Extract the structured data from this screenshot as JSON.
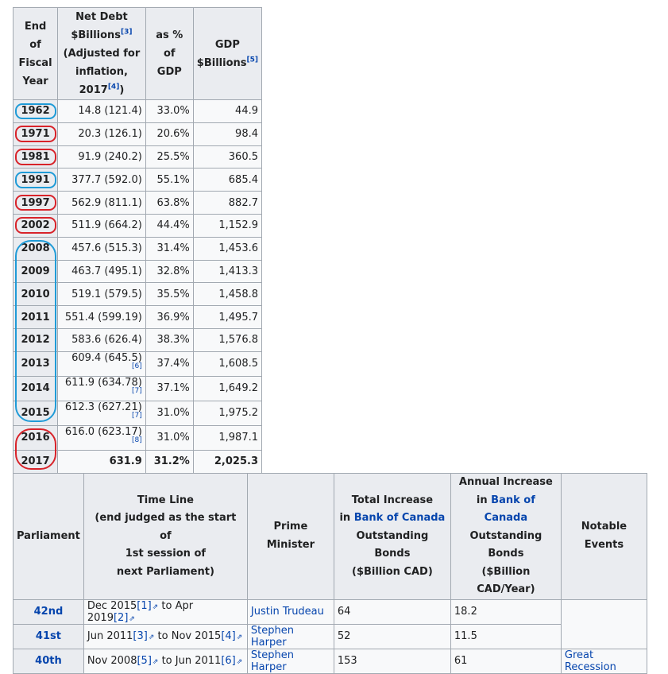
{
  "debt_table": {
    "headers": {
      "year_line1": "End",
      "year_line2": "of",
      "year_line3": "Fiscal",
      "year_line4": "Year",
      "net_debt_line1": "Net Debt",
      "net_debt_line2": "$Billions",
      "net_debt_ref": "[3]",
      "net_debt_line3": "(Adjusted for",
      "net_debt_line4": "inflation, 2017",
      "net_debt_ref2": "[4]",
      "net_debt_close": ")",
      "pct_line1": "as % of",
      "pct_line2": "GDP",
      "gdp_line1": "GDP",
      "gdp_line2": "$Billions",
      "gdp_ref": "[5]"
    },
    "rows": [
      {
        "year": "1962",
        "debt": "14.8 (121.4)",
        "ref": "",
        "pct": "33.0%",
        "gdp": "44.9"
      },
      {
        "year": "1971",
        "debt": "20.3 (126.1)",
        "ref": "",
        "pct": "20.6%",
        "gdp": "98.4"
      },
      {
        "year": "1981",
        "debt": "91.9 (240.2)",
        "ref": "",
        "pct": "25.5%",
        "gdp": "360.5"
      },
      {
        "year": "1991",
        "debt": "377.7 (592.0)",
        "ref": "",
        "pct": "55.1%",
        "gdp": "685.4"
      },
      {
        "year": "1997",
        "debt": "562.9 (811.1)",
        "ref": "",
        "pct": "63.8%",
        "gdp": "882.7"
      },
      {
        "year": "2002",
        "debt": "511.9 (664.2)",
        "ref": "",
        "pct": "44.4%",
        "gdp": "1,152.9"
      },
      {
        "year": "2008",
        "debt": "457.6 (515.3)",
        "ref": "",
        "pct": "31.4%",
        "gdp": "1,453.6"
      },
      {
        "year": "2009",
        "debt": "463.7 (495.1)",
        "ref": "",
        "pct": "32.8%",
        "gdp": "1,413.3"
      },
      {
        "year": "2010",
        "debt": "519.1 (579.5)",
        "ref": "",
        "pct": "35.5%",
        "gdp": "1,458.8"
      },
      {
        "year": "2011",
        "debt": "551.4 (599.19)",
        "ref": "",
        "pct": "36.9%",
        "gdp": "1,495.7"
      },
      {
        "year": "2012",
        "debt": "583.6 (626.4)",
        "ref": "",
        "pct": "38.3%",
        "gdp": "1,576.8"
      },
      {
        "year": "2013",
        "debt": "609.4 (645.5)",
        "ref": "[6]",
        "pct": "37.4%",
        "gdp": "1,608.5"
      },
      {
        "year": "2014",
        "debt": "611.9 (634.78)",
        "ref": "[7]",
        "pct": "37.1%",
        "gdp": "1,649.2"
      },
      {
        "year": "2015",
        "debt": "612.3 (627.21)",
        "ref": "[7]",
        "pct": "31.0%",
        "gdp": "1,975.2"
      },
      {
        "year": "2016",
        "debt": "616.0 (623.17)",
        "ref": "[8]",
        "pct": "31.0%",
        "gdp": "1,987.1"
      },
      {
        "year": "2017",
        "debt": "631.9",
        "ref": "",
        "pct": "31.2%",
        "gdp": "2,025.3"
      }
    ],
    "annotation_colors": {
      "red": "#d8232a",
      "blue": "#1f9bd7"
    }
  },
  "parliament_table": {
    "headers": {
      "parliament": "Parliament",
      "timeline_line1": "Time Line",
      "timeline_line2": "(end judged as the start of",
      "timeline_line3": "1st session of",
      "timeline_line4": "next Parliament)",
      "pm": "Prime Minister",
      "total_line1": "Total Increase",
      "total_line2_pre": "in ",
      "total_line2_link": "Bank of Canada",
      "total_line3": "Outstanding Bonds",
      "total_line4": "($Billion CAD)",
      "annual_line1": "Annual Increase",
      "annual_line2_pre": "in ",
      "annual_line2_link": "Bank of Canada",
      "annual_line3": "Outstanding Bonds",
      "annual_line4": "($Billion CAD/Year)",
      "events": "Notable Events"
    },
    "rows": [
      {
        "parliament": "42nd",
        "from": "Dec 2015",
        "from_ref": "[1]",
        "to_word": " to ",
        "to": "Apr 2019",
        "to_ref": "[2]",
        "pm": "Justin Trudeau",
        "total": "64",
        "annual": "18.2",
        "events": ""
      },
      {
        "parliament": "41st",
        "from": "Jun 2011",
        "from_ref": "[3]",
        "to_word": " to ",
        "to": "Nov 2015",
        "to_ref": "[4]",
        "pm": "Stephen Harper",
        "total": "52",
        "annual": "11.5",
        "events": ""
      },
      {
        "parliament": "40th",
        "from": "Nov 2008",
        "from_ref": "[5]",
        "to_word": " to ",
        "to": "Jun 2011",
        "to_ref": "[6]",
        "pm": "Stephen Harper",
        "total": "153",
        "annual": "61",
        "events": "Great Recession"
      }
    ],
    "external_link_icon": "external-link-icon"
  }
}
